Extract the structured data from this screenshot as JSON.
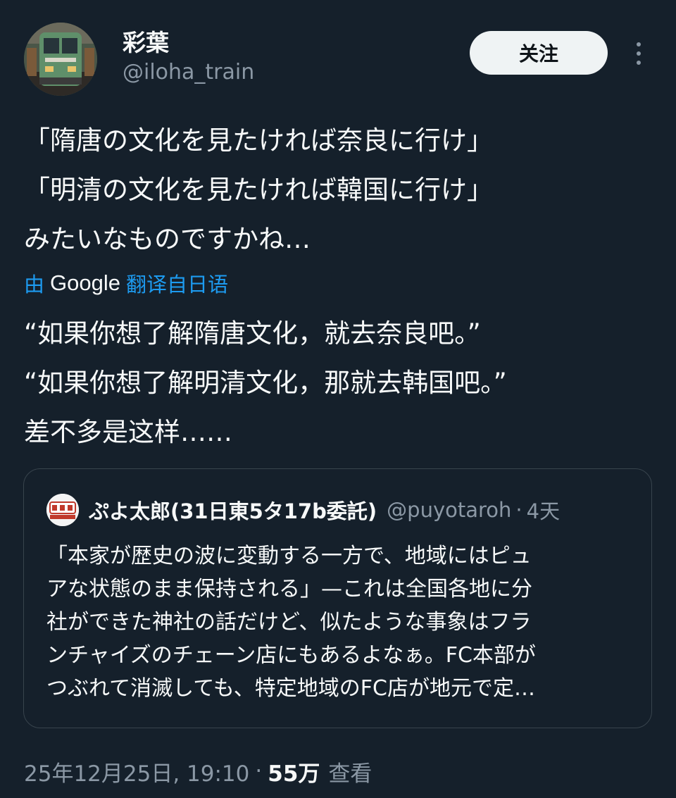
{
  "author": {
    "name": "彩葉",
    "handle": "@iloha_train",
    "avatar_icon": "train-photo-avatar"
  },
  "follow_label": "关注",
  "post": {
    "lines": [
      "「隋唐の文化を見たければ奈良に行け」",
      "「明清の文化を見たければ韓国に行け」",
      "みたいなものですかね…"
    ]
  },
  "translation": {
    "prefix": "由",
    "provider": "Google",
    "label": "翻译自日语",
    "lines": [
      "“如果你想了解隋唐文化，就去奈良吧。”",
      "“如果你想了解明清文化，那就去韩国吧。”",
      "差不多是这样……"
    ]
  },
  "quote": {
    "name": "ぷよ太郎(31日東5タ17b委託)",
    "handle": "@puyotaroh",
    "separator": "·",
    "time": "4天",
    "avatar_icon": "puyotaroh-logo-avatar",
    "lines": [
      "「本家が歴史の波に変動する一方で、地域にはピュ",
      "アな状態のまま保持される」—これは全国各地に分",
      "社ができた神社の話だけど、似たような事象はフラ",
      "ンチャイズのチェーン店にもあるよなぁ。FC本部が",
      "つぶれて消滅しても、特定地域のFC店が地元で定…"
    ]
  },
  "meta": {
    "timestamp": "25年12月25日, 19:10",
    "separator": "·",
    "views_count": "55万",
    "views_label": "查看"
  },
  "colors": {
    "background": "#15202b",
    "text": "#f7f9f9",
    "secondary": "#8b98a5",
    "link": "#1d9bf0",
    "border": "#38444d"
  }
}
